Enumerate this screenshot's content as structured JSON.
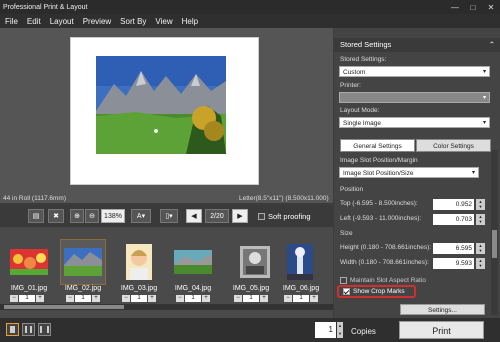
{
  "window": {
    "title": "Professional Print & Layout"
  },
  "menu": {
    "items": [
      "File",
      "Edit",
      "Layout",
      "Preview",
      "Sort By",
      "View",
      "Help"
    ]
  },
  "status": {
    "left": "44 in Roll (1117.6mm)",
    "right": "Letter(8.5\"x11\") (8.500x11.000)"
  },
  "toolbar": {
    "zoom": "138%",
    "page": "2/20",
    "soft_proofing": "Soft proofing"
  },
  "thumbnails": [
    {
      "name": "IMG_01.jpg",
      "qty": "1"
    },
    {
      "name": "IMG_02.jpg",
      "qty": "1"
    },
    {
      "name": "IMG_03.jpg",
      "qty": "1"
    },
    {
      "name": "IMG_04.jpg",
      "qty": "1"
    },
    {
      "name": "IMG_05.jpg",
      "qty": "1"
    },
    {
      "name": "IMG_06.jpg",
      "qty": "1"
    }
  ],
  "bottom": {
    "copies_value": "1",
    "copies_label": "Copies",
    "print_label": "Print"
  },
  "panel": {
    "stored_header": "Stored Settings",
    "stored_label": "Stored Settings:",
    "stored_value": "Custom",
    "printer_label": "Printer:",
    "printer_value": "",
    "layout_mode_label": "Layout Mode:",
    "layout_mode_value": "Single Image",
    "tab_general": "General Settings",
    "tab_color": "Color Settings",
    "slot_label": "Image Slot Position/Margin",
    "slot_value": "Image Slot Position/Size",
    "position_label": "Position",
    "top_label": "Top (-6.595 - 8.500inches):",
    "top_value": "0.952",
    "left_label": "Left (-9.593 - 11.000inches):",
    "left_value": "0.703",
    "size_label": "Size",
    "height_label": "Height (0.180 - 708.661inches):",
    "height_value": "6.595",
    "width_label": "Width (0.180 - 708.661inches):",
    "width_value": "9.593",
    "maintain_label": "Maintain Slot Aspect Ratio",
    "crop_label": "Show Crop Marks",
    "settings_button": "Settings..."
  },
  "colors": {
    "accent": "#e8a030",
    "highlight": "#d03030"
  }
}
